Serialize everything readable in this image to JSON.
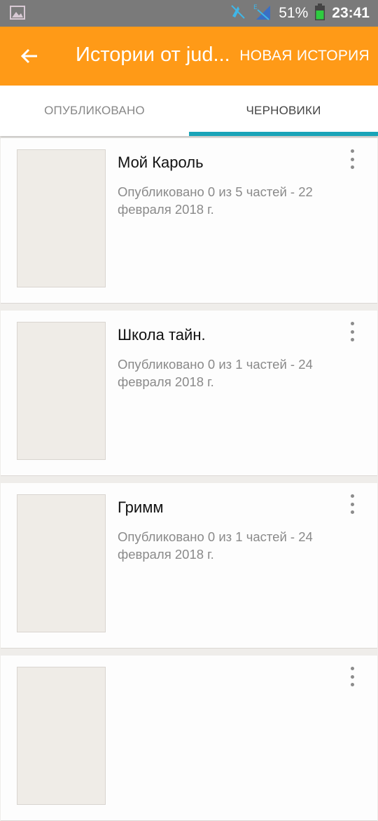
{
  "status_bar": {
    "battery_percent": "51%",
    "time": "23:41",
    "icons": [
      "image-icon",
      "mute-icon",
      "signal-icon",
      "battery-icon"
    ]
  },
  "toolbar": {
    "title": "Истории от jud...",
    "new_story_label": "НОВАЯ ИСТОРИЯ",
    "back_icon": "arrow-back-icon"
  },
  "tabs": [
    {
      "label": "ОПУБЛИКОВАНО",
      "active": false
    },
    {
      "label": "ЧЕРНОВИКИ",
      "active": true
    }
  ],
  "stories": [
    {
      "title": "Мой Кароль",
      "subtitle": "Опубликовано 0 из 5 частей - 22 февраля 2018 г."
    },
    {
      "title": "Школа тайн.",
      "subtitle": "Опубликовано 0 из 1 частей - 24 февраля 2018 г."
    },
    {
      "title": "Гримм",
      "subtitle": "Опубликовано 0 из 1 частей - 24 февраля 2018 г."
    },
    {
      "title": "",
      "subtitle": ""
    }
  ],
  "colors": {
    "toolbar": "#ff9a17",
    "tab_indicator": "#1aa4b8",
    "status_bar": "#7a7a7a"
  }
}
